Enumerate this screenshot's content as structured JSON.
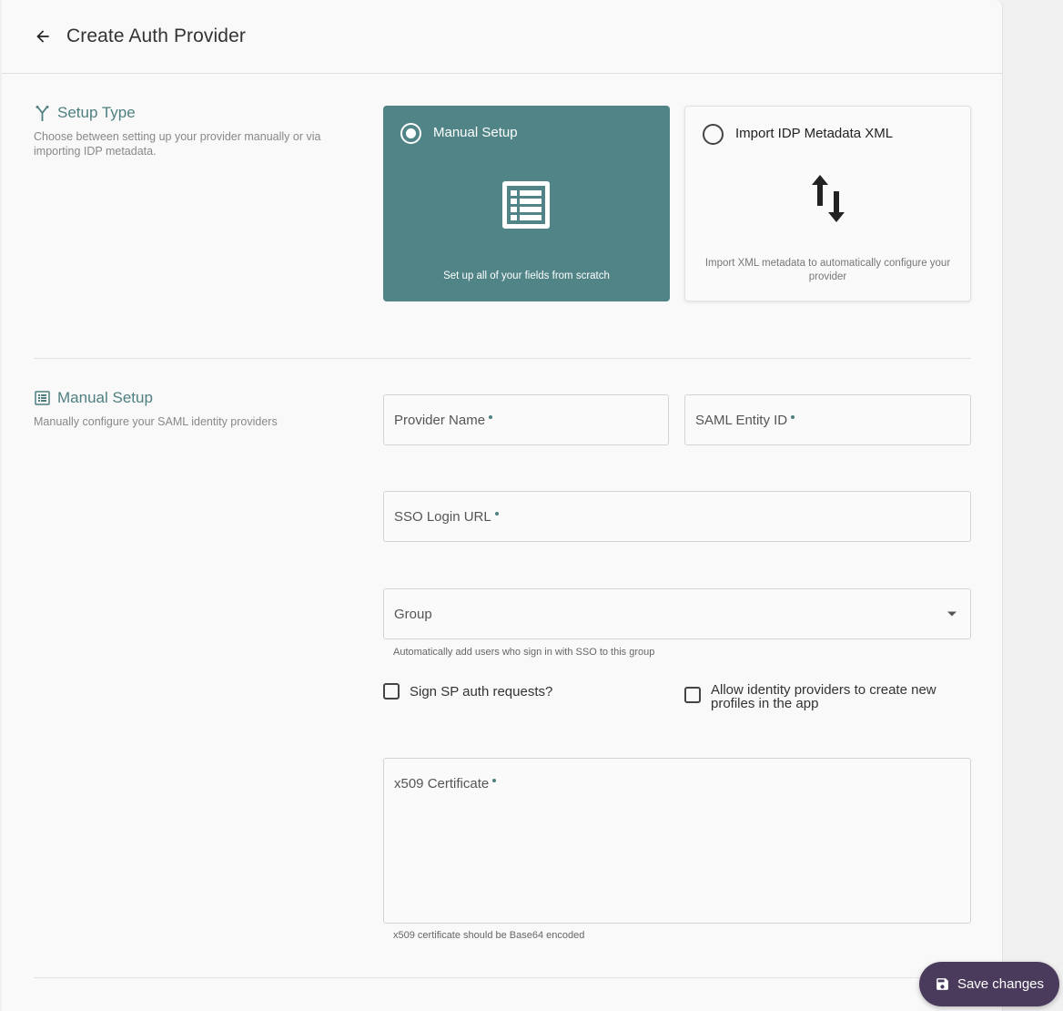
{
  "header": {
    "title": "Create Auth Provider"
  },
  "setup_type": {
    "title": "Setup Type",
    "description": "Choose between setting up your provider manually or via importing IDP metadata.",
    "options": [
      {
        "label": "Manual Setup",
        "description": "Set up all of your fields from scratch",
        "selected": true
      },
      {
        "label": "Import IDP Metadata XML",
        "description": "Import XML metadata to automatically configure your provider",
        "selected": false
      }
    ]
  },
  "manual_setup": {
    "title": "Manual Setup",
    "description": "Manually configure your SAML identity providers",
    "fields": {
      "provider_name": {
        "label": "Provider Name",
        "value": ""
      },
      "saml_entity_id": {
        "label": "SAML Entity ID",
        "value": ""
      },
      "sso_login_url": {
        "label": "SSO Login URL",
        "value": ""
      },
      "group": {
        "label": "Group",
        "helper": "Automatically add users who sign in with SSO to this group"
      },
      "x509": {
        "label": "x509 Certificate",
        "helper": "x509 certificate should be Base64 encoded"
      }
    },
    "checkboxes": {
      "sign_sp": {
        "label": "Sign SP auth requests?",
        "checked": false
      },
      "allow_idp": {
        "label": "Allow identity providers to create new profiles in the app",
        "checked": false
      }
    }
  },
  "save_button": {
    "label": "Save changes"
  },
  "colors": {
    "accent": "#508486",
    "title": "#4f7f80",
    "save_button": "#4a3b5c"
  }
}
